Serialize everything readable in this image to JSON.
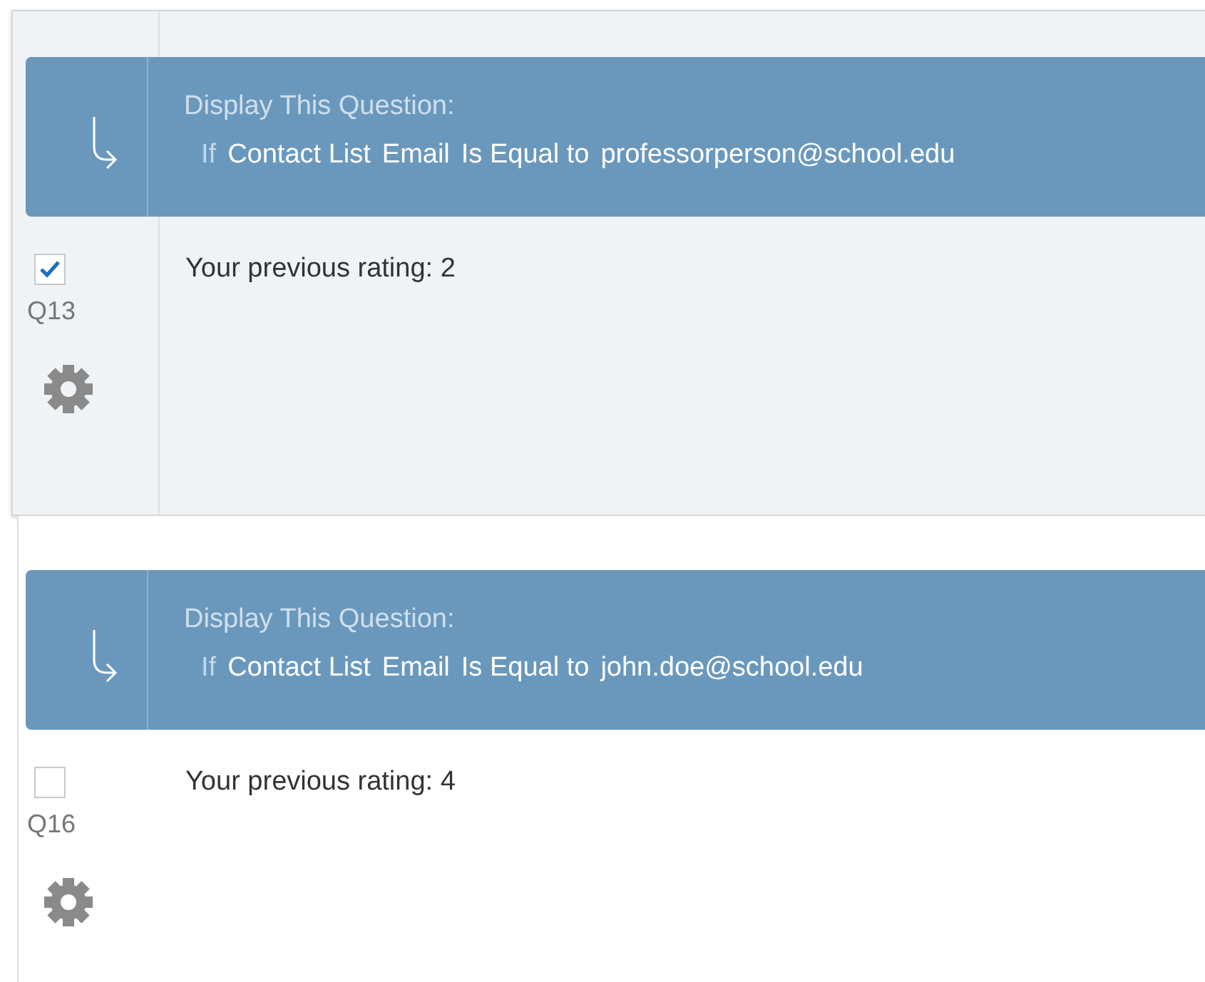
{
  "questions": [
    {
      "selected": true,
      "display_logic": {
        "title": "Display This Question:",
        "condition": [
          {
            "kind": "keyword",
            "text": "If"
          },
          {
            "kind": "term",
            "text": "Contact List"
          },
          {
            "kind": "term",
            "text": "Email"
          },
          {
            "kind": "term",
            "text": "Is Equal to"
          },
          {
            "kind": "term",
            "text": "professorperson@school.edu"
          }
        ]
      },
      "checked": true,
      "number": "Q13",
      "text": "Your previous rating: 2"
    },
    {
      "selected": false,
      "display_logic": {
        "title": "Display This Question:",
        "condition": [
          {
            "kind": "keyword",
            "text": "If"
          },
          {
            "kind": "term",
            "text": "Contact List"
          },
          {
            "kind": "term",
            "text": "Email"
          },
          {
            "kind": "term",
            "text": "Is Equal to"
          },
          {
            "kind": "term",
            "text": "john.doe@school.edu"
          }
        ]
      },
      "checked": false,
      "number": "Q16",
      "text": "Your previous rating: 4"
    }
  ]
}
